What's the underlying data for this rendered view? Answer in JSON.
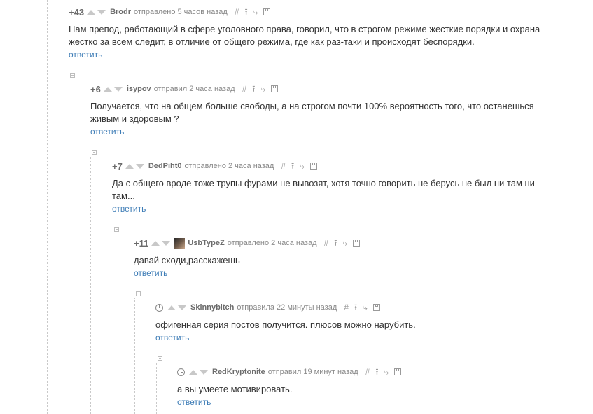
{
  "comments": [
    {
      "rating": "+43",
      "author": "Brodr",
      "meta": "отправлено 5 часов назад",
      "text": "Нам препод, работающий в сфере уголовного права, говорил, что в строгом режиме жесткие порядки и охрана жестко за всем следит, в отличие от общего режима, где как раз-таки и происходят беспорядки.",
      "reply": "ответить"
    },
    {
      "rating": "+6",
      "author": "isypov",
      "meta": "отправил 2 часа назад",
      "text": "Получается, что на общем больше свободы, а на строгом почти 100% вероятность того, что останешься живым и здоровым ?",
      "reply": "ответить"
    },
    {
      "rating": "+7",
      "author": "DedPiht0",
      "meta": "отправлено 2 часа назад",
      "text": "Да с общего вроде тоже трупы фурами не вывозят, хотя точно говорить не берусь не был ни там ни там...",
      "reply": "ответить"
    },
    {
      "rating": "+11",
      "author": "UsbTypeZ",
      "meta": "отправлено 2 часа назад",
      "text": "давай сходи,расскажешь",
      "reply": "ответить"
    },
    {
      "rating": "",
      "author": "Skinnybitch",
      "meta": "отправила 22 минуты назад",
      "text": "офигенная серия постов получится. плюсов можно нарубить.",
      "reply": "ответить"
    },
    {
      "rating": "",
      "author": "RedKryptonite",
      "meta": "отправил 19 минут назад",
      "text": "а вы умеете мотивировать.",
      "reply": "ответить"
    }
  ],
  "tools": {
    "hash": "#",
    "up": "⭱",
    "branch": "⤷"
  },
  "colors": {
    "link": "#3d7cb6",
    "text": "#333333",
    "muted": "#8a8a8a",
    "vote": "#c8c8c8"
  }
}
